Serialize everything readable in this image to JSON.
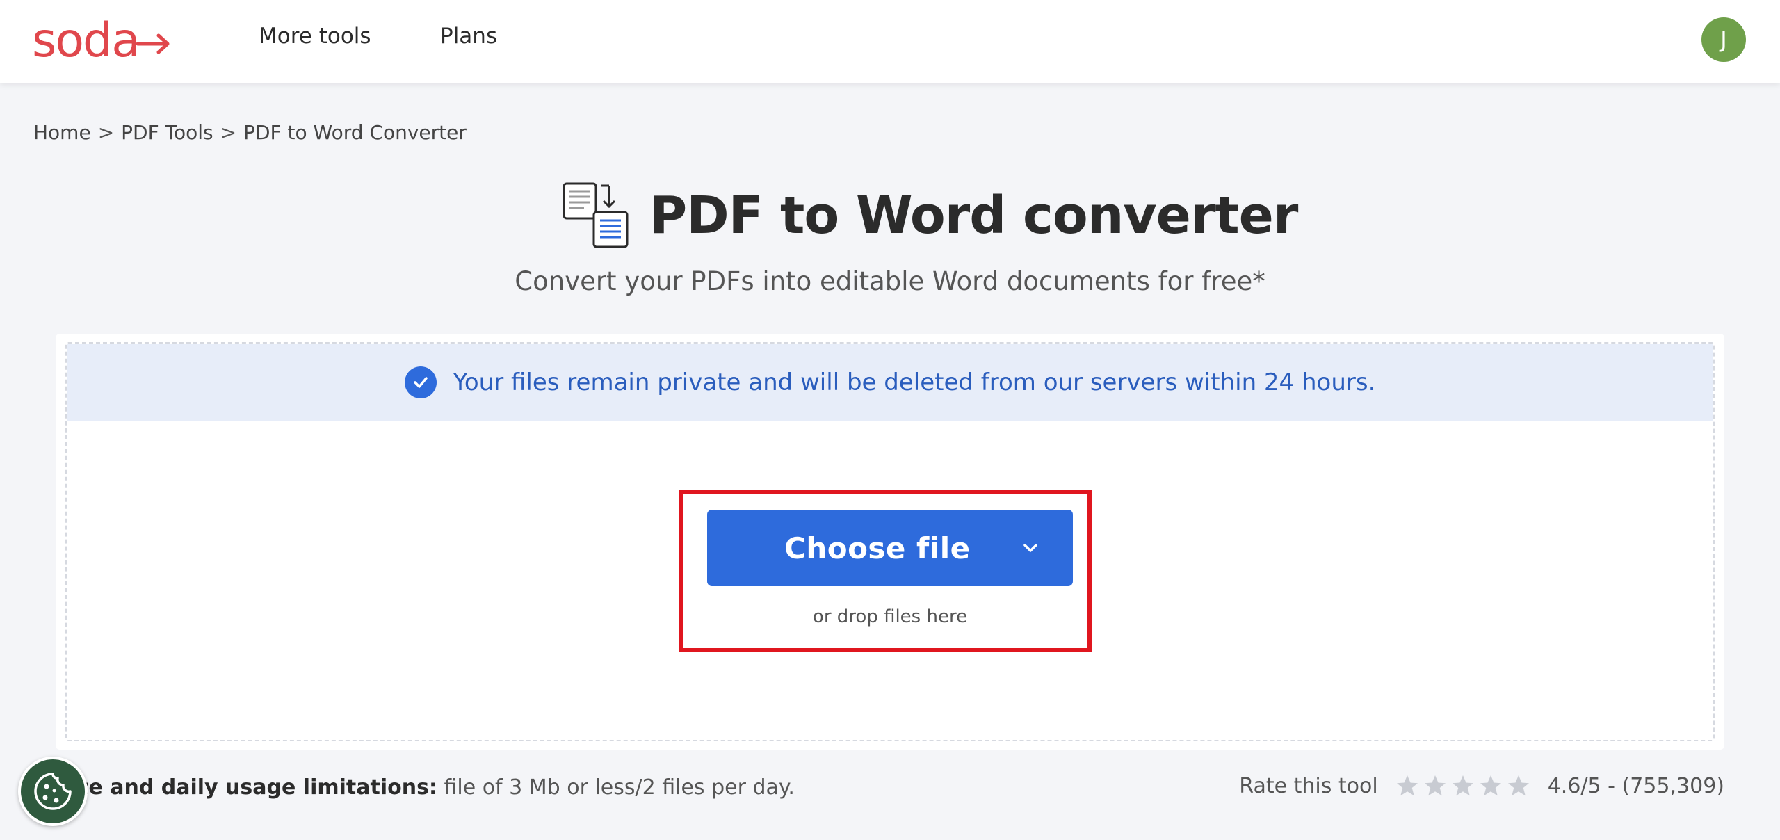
{
  "header": {
    "logo_text": "soda",
    "nav": [
      {
        "label": "More tools"
      },
      {
        "label": "Plans"
      }
    ],
    "avatar_initial": "J",
    "avatar_color": "#6fa04a"
  },
  "breadcrumb": {
    "items": [
      "Home",
      "PDF Tools",
      "PDF to Word Converter"
    ],
    "separator": ">"
  },
  "main": {
    "title": "PDF to Word converter",
    "subtitle": "Convert your PDFs into editable Word documents for free*",
    "title_icon": "document-convert-icon"
  },
  "upload": {
    "privacy_notice": "Your files remain private and will be deleted from our servers within 24 hours.",
    "choose_button": "Choose file",
    "drop_hint": "or drop files here",
    "accent_color": "#2e6bdc"
  },
  "footer": {
    "limits_label": "ze and daily usage limitations:",
    "limits_value": "file of 3 Mb or less/2 files per day.",
    "rate_label": "Rate this tool",
    "rating_text": "4.6/5 - (755,309)",
    "stars_total": 5
  }
}
